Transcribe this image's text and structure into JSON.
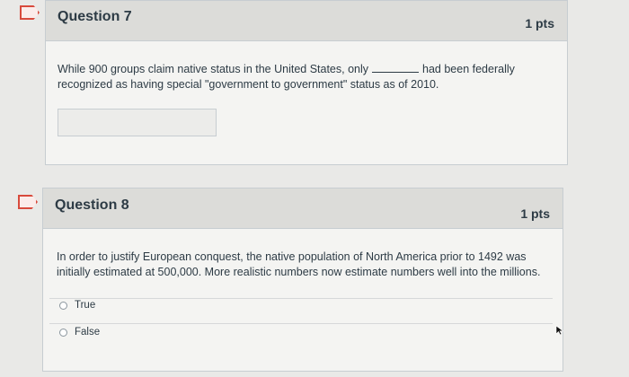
{
  "questions": [
    {
      "title": "Question 7",
      "points": "1 pts",
      "text_before": "While 900 groups claim native status in the United States, only",
      "text_after": "had been federally recognized as having special \"government to government\" status as of 2010.",
      "answer_value": ""
    },
    {
      "title": "Question 8",
      "points": "1 pts",
      "text": "In order to justify European conquest, the native population of North America prior to 1492 was initially estimated at 500,000. More realistic numbers now estimate numbers well into the millions.",
      "options": [
        "True",
        "False"
      ]
    }
  ],
  "colors": {
    "flag": "#d84a3c",
    "header_bg": "#dcdcd9",
    "card_bg": "#f4f4f2",
    "page_bg": "#e9e9e7"
  }
}
